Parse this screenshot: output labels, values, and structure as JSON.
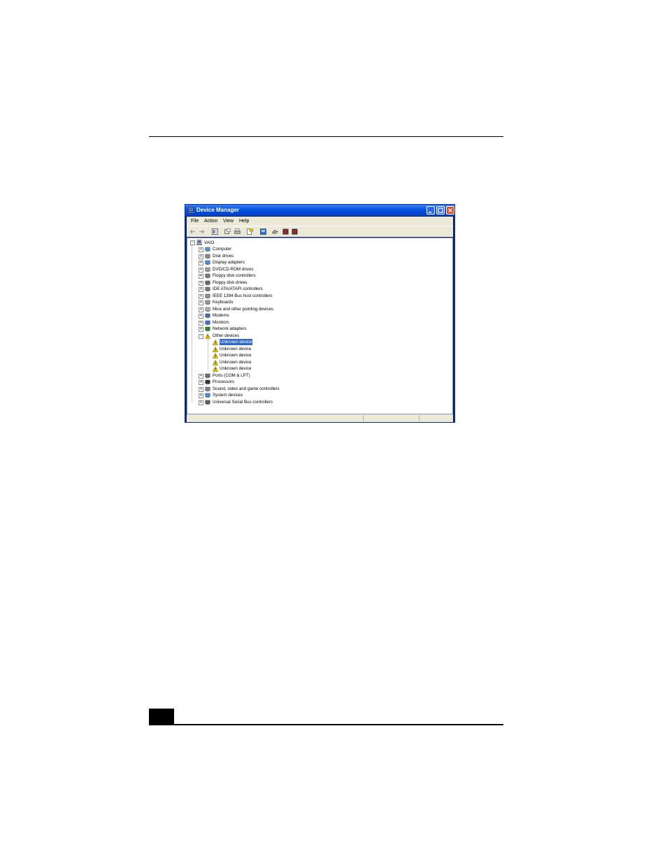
{
  "window": {
    "title": "Device Manager",
    "controls": [
      "minimize-icon",
      "maximize-icon",
      "close-icon"
    ]
  },
  "menu": [
    "File",
    "Action",
    "View",
    "Help"
  ],
  "toolbar": [
    "back-arrow-icon",
    "forward-arrow-icon",
    "properties-view-icon",
    "update-driver-icon",
    "print-icon",
    "help-icon",
    "scan-hardware-icon",
    "uninstall-icon",
    "disable-icon",
    "enable-icon"
  ],
  "tree": {
    "root": "VAIO",
    "categories": [
      {
        "label": "Computer",
        "icon": "computer-icon"
      },
      {
        "label": "Disk drives",
        "icon": "disk-drive-icon"
      },
      {
        "label": "Display adapters",
        "icon": "display-adapter-icon"
      },
      {
        "label": "DVD/CD-ROM drives",
        "icon": "cdrom-icon"
      },
      {
        "label": "Floppy disk controllers",
        "icon": "floppy-controller-icon"
      },
      {
        "label": "Floppy disk drives",
        "icon": "floppy-drive-icon"
      },
      {
        "label": "IDE ATA/ATAPI controllers",
        "icon": "ide-controller-icon"
      },
      {
        "label": "IEEE 1394 Bus host controllers",
        "icon": "ieee1394-icon"
      },
      {
        "label": "Keyboards",
        "icon": "keyboard-icon"
      },
      {
        "label": "Mice and other pointing devices",
        "icon": "mouse-icon"
      },
      {
        "label": "Modems",
        "icon": "modem-icon"
      },
      {
        "label": "Monitors",
        "icon": "monitor-icon"
      },
      {
        "label": "Network adapters",
        "icon": "network-adapter-icon"
      },
      {
        "label": "Other devices",
        "icon": "other-devices-icon",
        "expanded": true,
        "children": [
          "Unknown device",
          "Unknown device",
          "Unknown device",
          "Unknown device",
          "Unknown device"
        ]
      },
      {
        "label": "Ports (COM & LPT)",
        "icon": "ports-icon"
      },
      {
        "label": "Processors",
        "icon": "processor-icon"
      },
      {
        "label": "Sound, video and game controllers",
        "icon": "sound-icon"
      },
      {
        "label": "System devices",
        "icon": "system-devices-icon"
      },
      {
        "label": "Universal Serial Bus controllers",
        "icon": "usb-icon"
      }
    ]
  },
  "selected": "Unknown device",
  "colors": {
    "titlebar": "#0a58e0",
    "selection": "#316ac5",
    "chrome": "#ece9d8",
    "warning": "#f0d000"
  }
}
